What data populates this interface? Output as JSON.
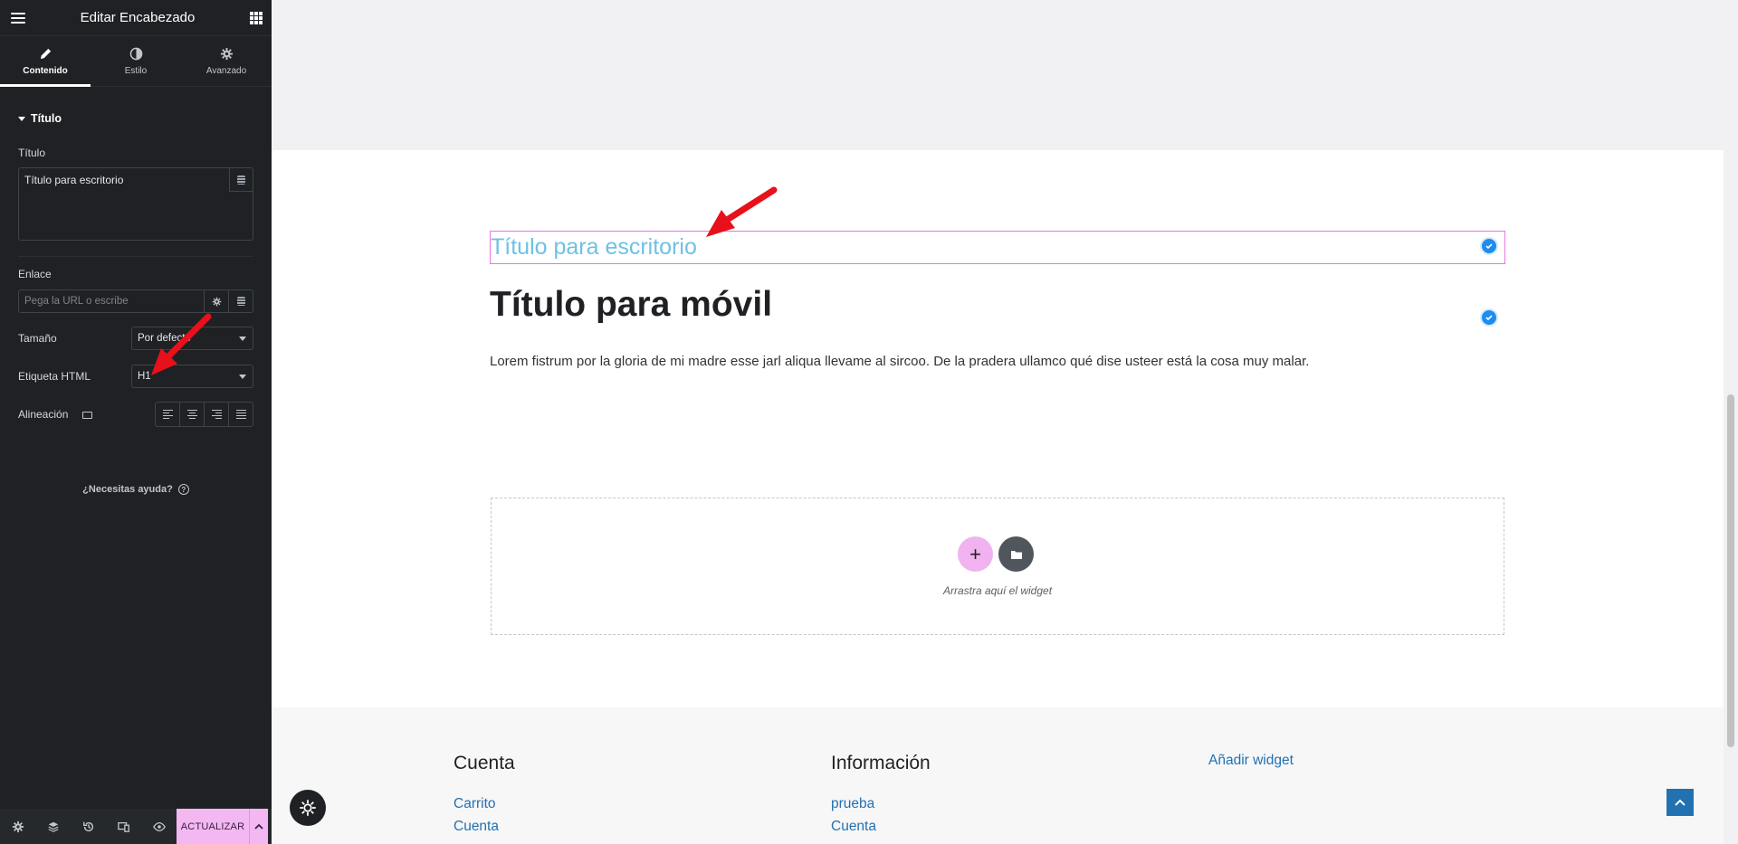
{
  "sidebar": {
    "header_title": "Editar Encabezado",
    "tabs": [
      {
        "label": "Contenido",
        "icon": "pencil-icon",
        "active": true
      },
      {
        "label": "Estilo",
        "icon": "contrast-icon",
        "active": false
      },
      {
        "label": "Avanzado",
        "icon": "gear-icon",
        "active": false
      }
    ],
    "section_title": "Título",
    "title_label": "Título",
    "title_value": "Título para escritorio",
    "link_label": "Enlace",
    "link_placeholder": "Pega la URL o escribe",
    "size_label": "Tamaño",
    "size_value": "Por defecto",
    "html_tag_label": "Etiqueta HTML",
    "html_tag_value": "H1",
    "alignment_label": "Alineación",
    "help_text": "¿Necesitas ayuda?",
    "update_label": "ACTUALIZAR",
    "update_color": "#f3b8f2"
  },
  "canvas": {
    "heading_desktop": "Título para escritorio",
    "heading_mobile": "Título para móvil",
    "paragraph": "Lorem fistrum por la gloria de mi madre esse jarl aliqua llevame al sircoo. De la pradera ullamco qué dise usteer está la cosa muy malar.",
    "drop_text": "Arrastra aquí el widget",
    "accent_color": "#6ec1e4",
    "selection_color": "#e874e4"
  },
  "footer": {
    "col1_title": "Cuenta",
    "col1_links": [
      "Carrito",
      "Cuenta"
    ],
    "col2_title": "Información",
    "col2_links": [
      "prueba",
      "Cuenta"
    ],
    "add_widget": "Añadir widget",
    "link_color": "#2271b1"
  }
}
